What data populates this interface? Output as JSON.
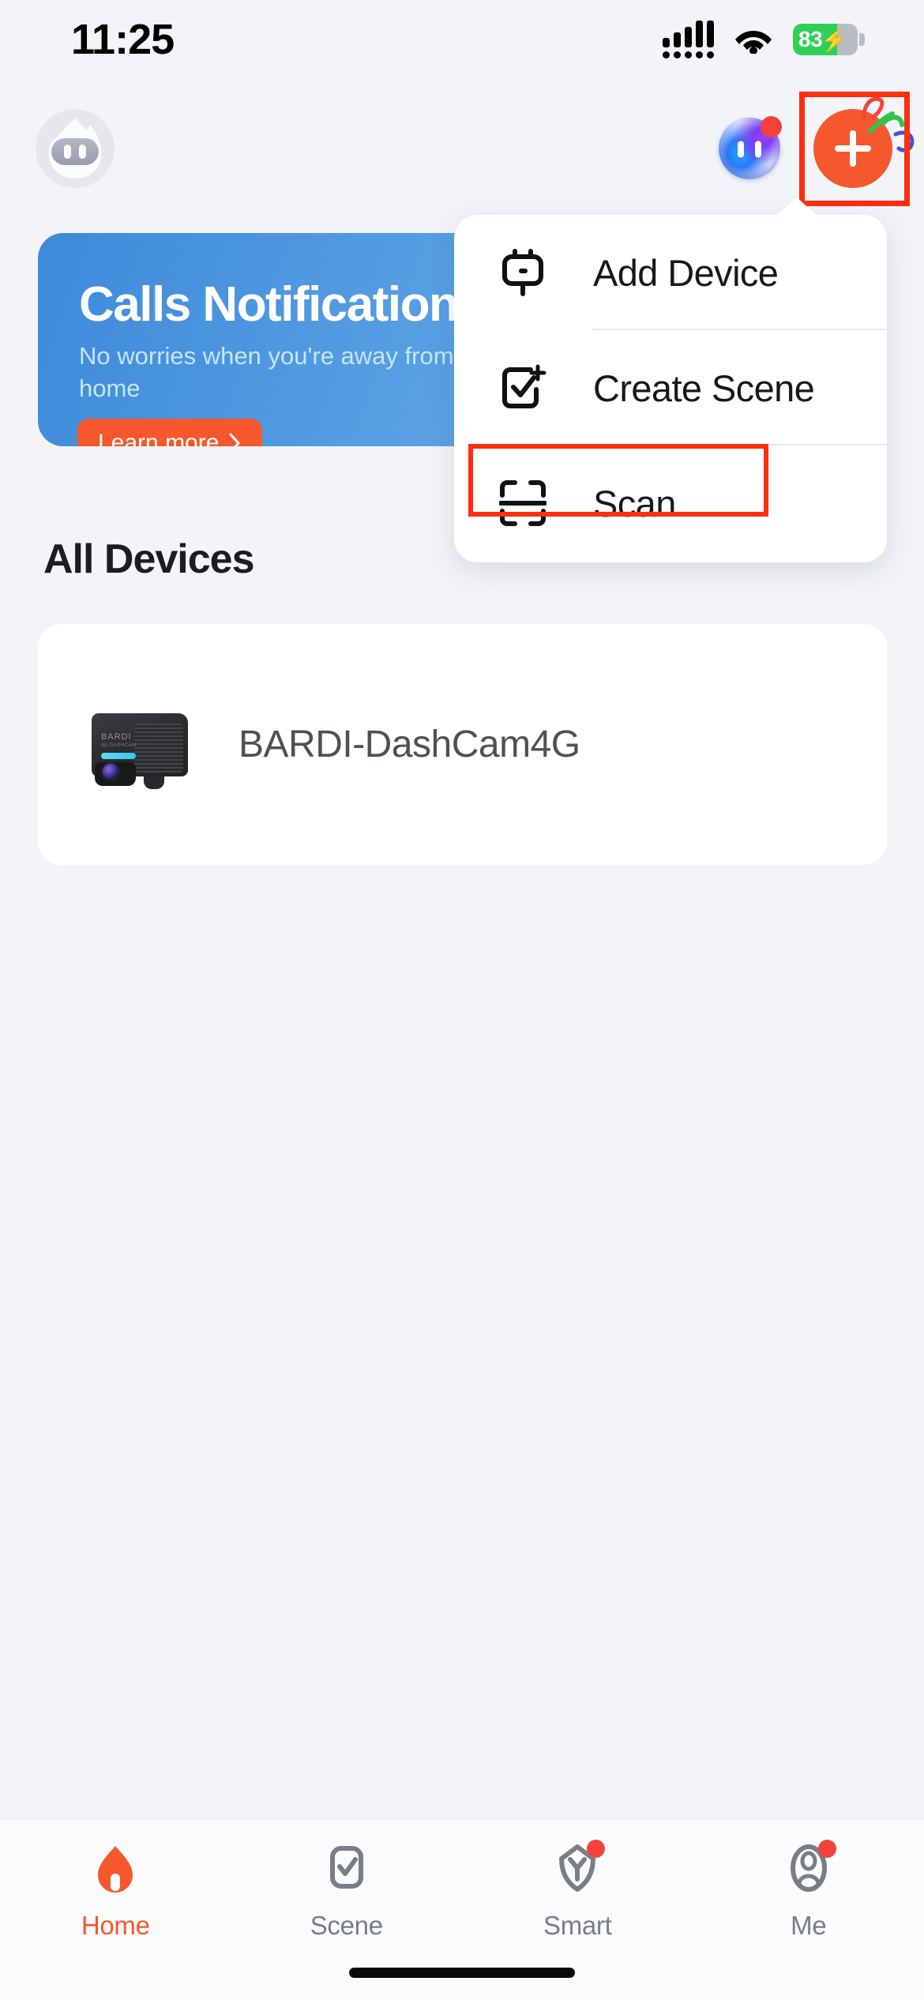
{
  "status_bar": {
    "time": "11:25",
    "cellular_icon": "signal-bars-icon",
    "wifi_icon": "wifi-icon",
    "battery_percent": "83",
    "battery_charging_icon": "charging-bolt-icon",
    "battery_color": "#2ed158"
  },
  "header": {
    "avatar_name": "user-avatar",
    "ai_assistant_icon": "ai-orb-icon",
    "ai_assistant_has_badge": true,
    "add_button_icon": "plus-icon",
    "add_button_color": "#f4582c"
  },
  "banner": {
    "title": "Calls Notification",
    "subtitle": "No worries when you're away from home",
    "cta_label": "Learn more",
    "cta_chevron": "chevron-right-icon",
    "cta_color": "#f4582c",
    "bg_start": "#3d8ada",
    "bg_end": "#76b4ec"
  },
  "sections": {
    "all_devices_title": "All Devices"
  },
  "devices": [
    {
      "name": "BARDI-DashCam4G",
      "image_brand_text": "BARDI",
      "image_sub_text": "4G DASHCAM",
      "icon": "dashcam-device-image"
    }
  ],
  "dropdown_menu": {
    "items": [
      {
        "label": "Add Device",
        "icon": "plug-socket-icon",
        "highlighted": false
      },
      {
        "label": "Create Scene",
        "icon": "checkbox-plus-icon",
        "highlighted": false
      },
      {
        "label": "Scan",
        "icon": "qr-scan-icon",
        "highlighted": true
      }
    ]
  },
  "highlights": {
    "color": "#fd2f10",
    "targets": [
      "add-button",
      "menu-item-scan"
    ]
  },
  "tab_bar": {
    "tabs": [
      {
        "label": "Home",
        "icon": "home-icon",
        "active": true,
        "badge": false
      },
      {
        "label": "Scene",
        "icon": "scene-check-icon",
        "active": false,
        "badge": false
      },
      {
        "label": "Smart",
        "icon": "smart-shield-icon",
        "active": false,
        "badge": true
      },
      {
        "label": "Me",
        "icon": "profile-icon",
        "active": false,
        "badge": true
      }
    ],
    "active_color": "#f4582c",
    "inactive_color": "#7a7e84"
  }
}
